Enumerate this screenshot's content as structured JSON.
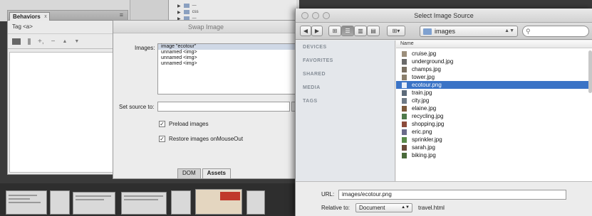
{
  "behaviors_panel": {
    "tab_label": "Behaviors",
    "close_label": "x",
    "menu_icon": "menu-icon",
    "tag_label": "Tag <a>",
    "toolbar": {
      "add": "+,",
      "remove": "−",
      "up": "▲",
      "down": "▼"
    }
  },
  "background": {
    "folder_rows": [
      "css"
    ]
  },
  "swap_image": {
    "title": "Swap Image",
    "images_label": "Images:",
    "images": [
      "image \"ecotour\"",
      "unnamed <img>",
      "unnamed <img>",
      "unnamed <img>"
    ],
    "set_source_label": "Set source to:",
    "set_source_value": "",
    "preload_label": "Preload images",
    "restore_label": "Restore images onMouseOut",
    "bottom_tabs": [
      "DOM",
      "Assets"
    ]
  },
  "select_image_source": {
    "title": "Select Image Source",
    "folder_name": "images",
    "search_placeholder": "",
    "sidebar_sections": [
      "DEVICES",
      "FAVORITES",
      "SHARED",
      "MEDIA",
      "TAGS"
    ],
    "column_header": "Name",
    "files": [
      "cruise.jpg",
      "underground.jpg",
      "champs.jpg",
      "tower.jpg",
      "ecotour.png",
      "train.jpg",
      "city.jpg",
      "elaine.jpg",
      "recycling.jpg",
      "shopping.jpg",
      "eric.png",
      "sprinkler.jpg",
      "sarah.jpg",
      "biking.jpg"
    ],
    "selected_file": "ecotour.png",
    "url_label": "URL:",
    "url_value": "images/ecotour.png",
    "relative_label": "Relative to:",
    "relative_value": "Document",
    "relative_file": "travel.html"
  },
  "colors": {
    "selection": "#3a73c6",
    "sidebar_text": "#858d96"
  }
}
